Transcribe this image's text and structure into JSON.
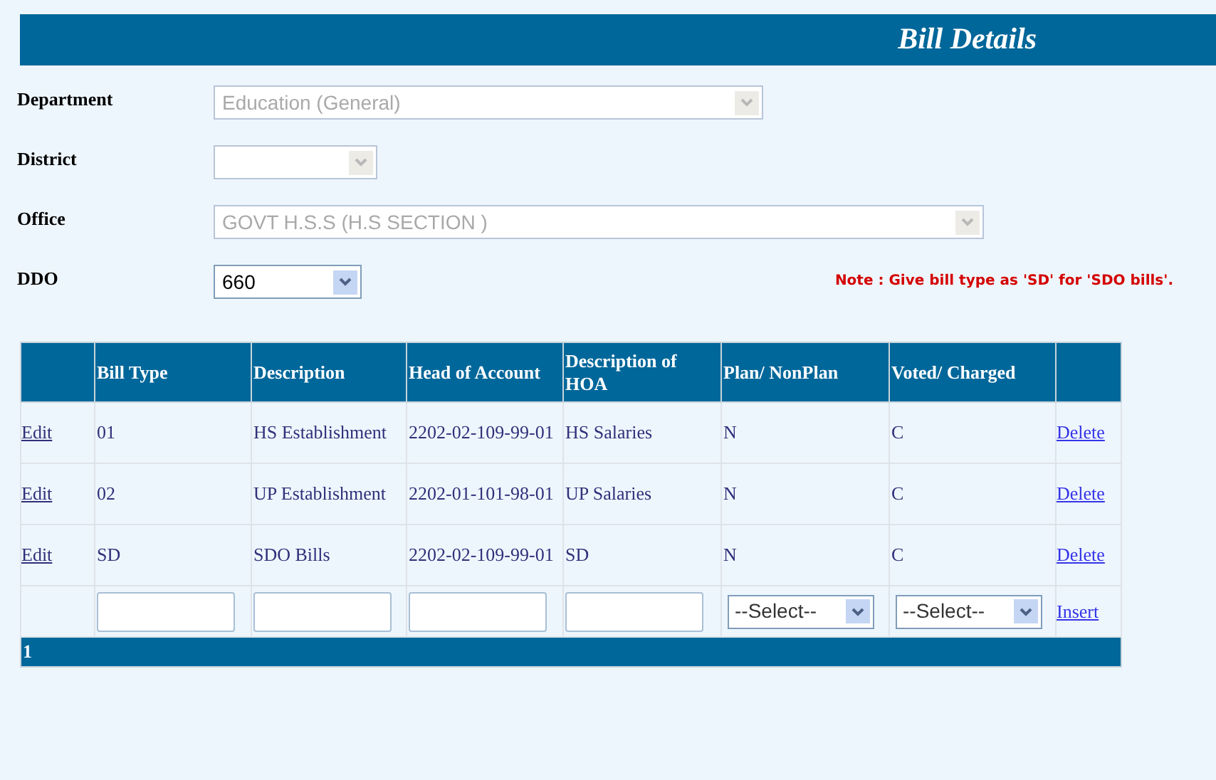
{
  "header": {
    "title": "Bill Details"
  },
  "form": {
    "fields": [
      {
        "label": "Department",
        "value": "Education (General)",
        "disabled": true
      },
      {
        "label": "District",
        "disabled": true
      },
      {
        "label": "Office",
        "value": "GOVT H.S.S (H.S SECTION )",
        "disabled": true
      },
      {
        "label": "DDO",
        "value": "660",
        "disabled": false
      }
    ],
    "note": "Note : Give bill type as 'SD' for 'SDO bills'."
  },
  "table": {
    "columns": [
      "Bill Type",
      "Description",
      "Head of Account",
      "Description of HOA",
      "Plan/ NonPlan",
      "Voted/ Charged"
    ],
    "rows": [
      {
        "edit": "Edit",
        "cells": [
          "01",
          "HS Establishment",
          "2202-02-109-99-01",
          "HS Salaries",
          "N",
          "C"
        ],
        "delete": "Delete"
      },
      {
        "edit": "Edit",
        "cells": [
          "02",
          "UP Establishment",
          "2202-01-101-98-01",
          "UP Salaries",
          "N",
          "C"
        ],
        "delete": "Delete"
      },
      {
        "edit": "Edit",
        "cells": [
          "SD",
          "SDO Bills",
          "2202-02-109-99-01",
          "SD",
          "N",
          "C"
        ],
        "delete": "Delete"
      }
    ],
    "insert_row": {
      "selects": [
        "--Select--",
        "--Select--"
      ],
      "action": "Insert"
    },
    "pager": "1"
  }
}
